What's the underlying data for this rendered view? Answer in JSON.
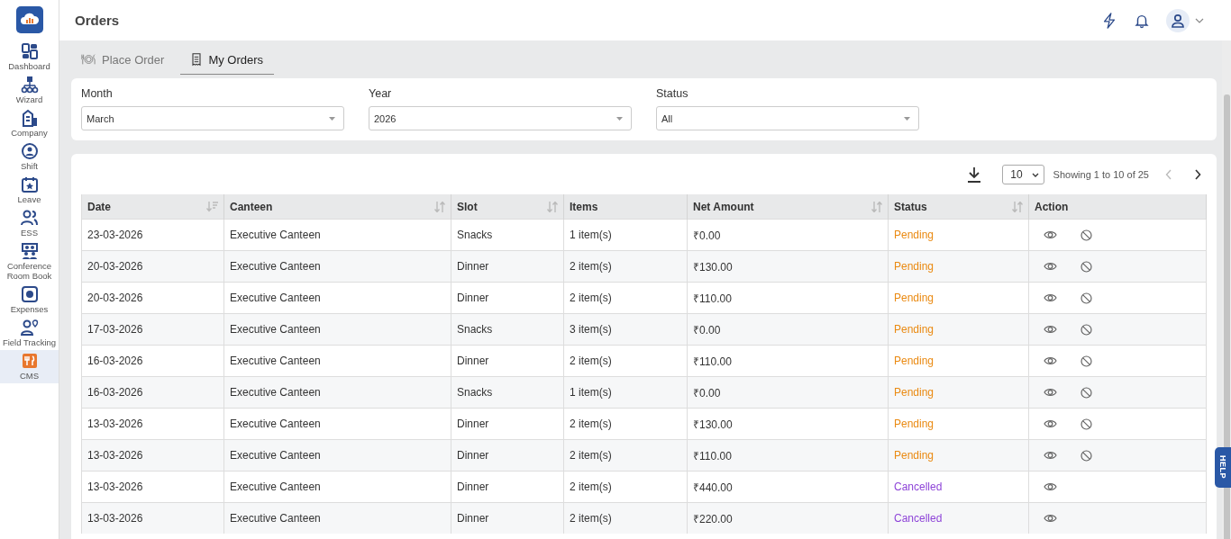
{
  "sidebar": {
    "items": [
      {
        "label": "Dashboard",
        "kind": "dashboard",
        "selected": false
      },
      {
        "label": "Wizard",
        "kind": "wizard",
        "selected": false
      },
      {
        "label": "Company",
        "kind": "company",
        "selected": false
      },
      {
        "label": "Shift",
        "kind": "shift",
        "selected": false
      },
      {
        "label": "Leave",
        "kind": "leave",
        "selected": false
      },
      {
        "label": "ESS",
        "kind": "ess",
        "selected": false
      },
      {
        "label": "Conference Room Book",
        "kind": "conference",
        "selected": false
      },
      {
        "label": "Expenses",
        "kind": "expenses",
        "selected": false
      },
      {
        "label": "Field Tracking",
        "kind": "field",
        "selected": false
      },
      {
        "label": "CMS",
        "kind": "cms",
        "selected": true
      }
    ]
  },
  "header": {
    "title": "Orders"
  },
  "tabs": [
    {
      "label": "Place Order",
      "kind": "plate",
      "selected": false
    },
    {
      "label": "My Orders",
      "kind": "receipt",
      "selected": true
    }
  ],
  "filters": [
    {
      "label": "Month",
      "value": "March"
    },
    {
      "label": "Year",
      "value": "2026"
    },
    {
      "label": "Status",
      "value": "All"
    }
  ],
  "pagination": {
    "page_size": "10",
    "summary": "Showing 1 to 10 of 25",
    "prev_disabled": true
  },
  "table": {
    "columns": [
      {
        "label": "Date",
        "kind": "sorted"
      },
      {
        "label": "Canteen",
        "kind": "sortable"
      },
      {
        "label": "Slot",
        "kind": "sortable"
      },
      {
        "label": "Items",
        "kind": "plain"
      },
      {
        "label": "Net Amount",
        "kind": "sortable"
      },
      {
        "label": "Status",
        "kind": "sortable"
      },
      {
        "label": "Action",
        "kind": "plain"
      }
    ],
    "rows": [
      {
        "date": "23-03-2026",
        "canteen": "Executive Canteen",
        "slot": "Snacks",
        "items": "1 item(s)",
        "amount": "₹0.00",
        "status": "Pending",
        "color": "#ea8a12",
        "cancellable": true
      },
      {
        "date": "20-03-2026",
        "canteen": "Executive Canteen",
        "slot": "Dinner",
        "items": "2 item(s)",
        "amount": "₹130.00",
        "status": "Pending",
        "color": "#ea8a12",
        "cancellable": true
      },
      {
        "date": "20-03-2026",
        "canteen": "Executive Canteen",
        "slot": "Dinner",
        "items": "2 item(s)",
        "amount": "₹110.00",
        "status": "Pending",
        "color": "#ea8a12",
        "cancellable": true
      },
      {
        "date": "17-03-2026",
        "canteen": "Executive Canteen",
        "slot": "Snacks",
        "items": "3 item(s)",
        "amount": "₹0.00",
        "status": "Pending",
        "color": "#ea8a12",
        "cancellable": true
      },
      {
        "date": "16-03-2026",
        "canteen": "Executive Canteen",
        "slot": "Dinner",
        "items": "2 item(s)",
        "amount": "₹110.00",
        "status": "Pending",
        "color": "#ea8a12",
        "cancellable": true
      },
      {
        "date": "16-03-2026",
        "canteen": "Executive Canteen",
        "slot": "Snacks",
        "items": "1 item(s)",
        "amount": "₹0.00",
        "status": "Pending",
        "color": "#ea8a12",
        "cancellable": true
      },
      {
        "date": "13-03-2026",
        "canteen": "Executive Canteen",
        "slot": "Dinner",
        "items": "2 item(s)",
        "amount": "₹130.00",
        "status": "Pending",
        "color": "#ea8a12",
        "cancellable": true
      },
      {
        "date": "13-03-2026",
        "canteen": "Executive Canteen",
        "slot": "Dinner",
        "items": "2 item(s)",
        "amount": "₹110.00",
        "status": "Pending",
        "color": "#ea8a12",
        "cancellable": true
      },
      {
        "date": "13-03-2026",
        "canteen": "Executive Canteen",
        "slot": "Dinner",
        "items": "2 item(s)",
        "amount": "₹440.00",
        "status": "Cancelled",
        "color": "#8e44d8",
        "cancellable": false
      },
      {
        "date": "13-03-2026",
        "canteen": "Executive Canteen",
        "slot": "Dinner",
        "items": "2 item(s)",
        "amount": "₹220.00",
        "status": "Cancelled",
        "color": "#8e44d8",
        "cancellable": false
      }
    ]
  },
  "help_tab": {
    "label": "HELP"
  }
}
